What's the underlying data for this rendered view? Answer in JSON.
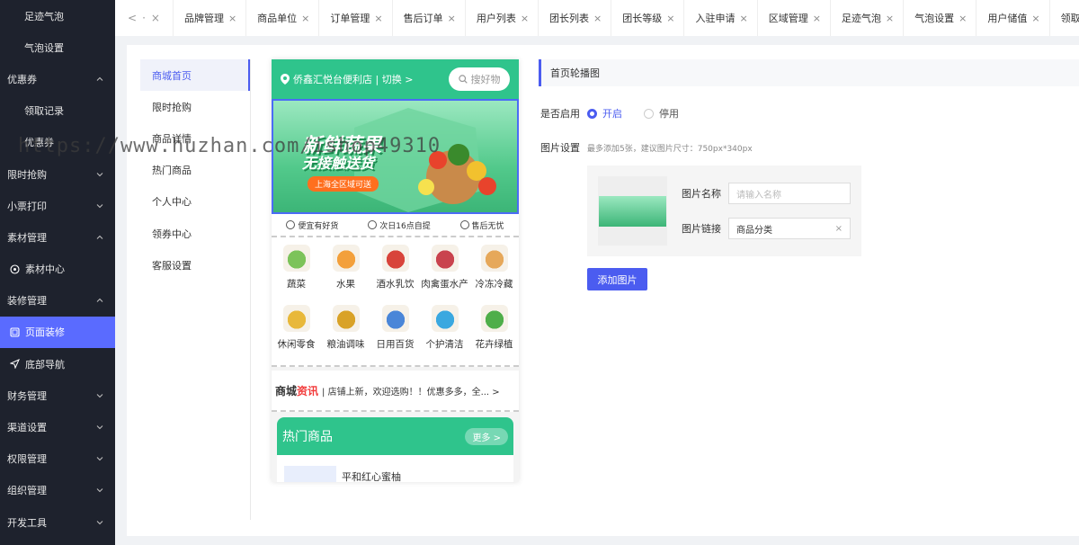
{
  "sidebar": {
    "items": [
      {
        "label": "足迹气泡",
        "type": "sub"
      },
      {
        "label": "气泡设置",
        "type": "sub"
      },
      {
        "label": "优惠券",
        "type": "top",
        "arrow": "up"
      },
      {
        "label": "领取记录",
        "type": "sub"
      },
      {
        "label": "优惠券",
        "type": "sub"
      },
      {
        "label": "限时抢购",
        "type": "top",
        "arrow": "down"
      },
      {
        "label": "小票打印",
        "type": "top",
        "arrow": "down"
      },
      {
        "label": "素材管理",
        "type": "top",
        "arrow": "up"
      },
      {
        "label": "素材中心",
        "type": "subicon",
        "icon": "material-icon"
      },
      {
        "label": "装修管理",
        "type": "top",
        "arrow": "up"
      },
      {
        "label": "页面装修",
        "type": "subicon",
        "icon": "page-icon",
        "active": true
      },
      {
        "label": "底部导航",
        "type": "subicon",
        "icon": "navigation-icon"
      },
      {
        "label": "财务管理",
        "type": "top",
        "arrow": "down"
      },
      {
        "label": "渠道设置",
        "type": "top",
        "arrow": "down"
      },
      {
        "label": "权限管理",
        "type": "top",
        "arrow": "down"
      },
      {
        "label": "组织管理",
        "type": "top",
        "arrow": "down"
      },
      {
        "label": "开发工具",
        "type": "top",
        "arrow": "down"
      }
    ]
  },
  "tabbar": {
    "nav": [
      "<",
      "·",
      "×"
    ],
    "tabs": [
      "品牌管理",
      "商品单位",
      "订单管理",
      "售后订单",
      "用户列表",
      "团长列表",
      "团长等级",
      "入驻申请",
      "区域管理",
      "足迹气泡",
      "气泡设置",
      "用户储值",
      "领取记录"
    ]
  },
  "leftnav": {
    "items": [
      "商城首页",
      "限时抢购",
      "商品详情",
      "热门商品",
      "个人中心",
      "领券中心",
      "客服设置"
    ],
    "active_index": 0
  },
  "phone": {
    "location": "侨鑫汇悦台便利店 | 切换 >",
    "search_placeholder": "搜好物",
    "banner": {
      "title_line1": "新鲜蔬果",
      "title_line2": "无接触送货",
      "tag": "上海全区域可送"
    },
    "features": [
      "便宜有好货",
      "次日16点自提",
      "售后无忧"
    ],
    "categories": [
      {
        "label": "蔬菜",
        "color": "#7cc35a"
      },
      {
        "label": "水果",
        "color": "#f3a03b"
      },
      {
        "label": "酒水乳饮",
        "color": "#d8443b"
      },
      {
        "label": "肉禽蛋水产",
        "color": "#c9434e"
      },
      {
        "label": "冷冻冷藏",
        "color": "#e6a85a"
      },
      {
        "label": "休闲零食",
        "color": "#e8b83a"
      },
      {
        "label": "粮油调味",
        "color": "#d9a227"
      },
      {
        "label": "日用百货",
        "color": "#4a86d8"
      },
      {
        "label": "个护清洁",
        "color": "#3aa8e0"
      },
      {
        "label": "花卉绿植",
        "color": "#4fae4a"
      }
    ],
    "news": {
      "brand_a": "商城",
      "brand_b": "资讯",
      "text": "| 店铺上新，欢迎选购！！优惠多多，全... >"
    },
    "hot": {
      "title": "热门商品",
      "more": "更多 >",
      "first_item": "平和红心蜜柚"
    }
  },
  "settings": {
    "header": "首页轮播图",
    "enable_label": "是否启用",
    "radio_on": "开启",
    "radio_off": "停用",
    "image_label": "图片设置",
    "image_hint": "最多添加5张，建议图片尺寸：750px*340px",
    "name_label": "图片名称",
    "name_placeholder": "请输入名称",
    "link_label": "图片链接",
    "link_value": "商品分类",
    "clear": "×",
    "add_button": "添加图片"
  },
  "watermark": "https://www.huzhan.com/ishop49310",
  "colors": {
    "sidebar_bg": "#1e222d",
    "accent": "#5a6bff",
    "phone_green": "#2fc48c"
  }
}
